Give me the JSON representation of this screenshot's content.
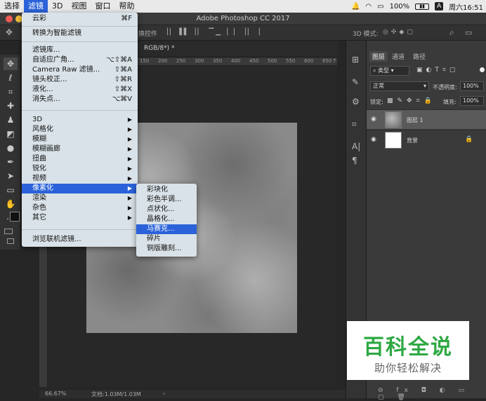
{
  "menubar": {
    "items": [
      "选择",
      "滤镜",
      "3D",
      "视图",
      "窗口",
      "帮助"
    ],
    "active_index": 1,
    "battery": "100%",
    "input_method": "A",
    "clock": "周六16:51"
  },
  "window": {
    "title": "Adobe Photoshop CC 2017"
  },
  "options_bar": {
    "label": "换控件",
    "mode_label": "3D 模式:"
  },
  "document": {
    "tab_label": "RGB/8*) *",
    "ruler_ticks": [
      "150",
      "200",
      "250",
      "300",
      "350",
      "400",
      "450",
      "500",
      "550",
      "600",
      "650",
      "7"
    ],
    "zoom": "66.67%",
    "doc_info": "文档:1.03M/1.03M"
  },
  "filter_menu": {
    "items": [
      {
        "label": "云彩",
        "shortcut": "⌘F"
      },
      {
        "label": "转换为智能滤镜",
        "shortcut": ""
      },
      {
        "label": "滤镜库...",
        "shortcut": ""
      },
      {
        "label": "自适应广角...",
        "shortcut": "⌥⇧⌘A"
      },
      {
        "label": "Camera Raw 滤镜...",
        "shortcut": "⇧⌘A"
      },
      {
        "label": "镜头校正...",
        "shortcut": "⇧⌘R"
      },
      {
        "label": "液化...",
        "shortcut": "⇧⌘X"
      },
      {
        "label": "消失点...",
        "shortcut": "⌥⌘V"
      },
      {
        "label": "3D",
        "shortcut": ""
      },
      {
        "label": "风格化",
        "shortcut": ""
      },
      {
        "label": "模糊",
        "shortcut": ""
      },
      {
        "label": "模糊画廊",
        "shortcut": ""
      },
      {
        "label": "扭曲",
        "shortcut": ""
      },
      {
        "label": "锐化",
        "shortcut": ""
      },
      {
        "label": "视频",
        "shortcut": ""
      },
      {
        "label": "像素化",
        "shortcut": ""
      },
      {
        "label": "渲染",
        "shortcut": ""
      },
      {
        "label": "杂色",
        "shortcut": ""
      },
      {
        "label": "其它",
        "shortcut": ""
      },
      {
        "label": "浏览联机滤镜...",
        "shortcut": ""
      }
    ],
    "highlighted": "像素化"
  },
  "pixelate_submenu": {
    "items": [
      "彩块化",
      "彩色半调...",
      "点状化...",
      "晶格化...",
      "马赛克...",
      "碎片",
      "铜版雕刻..."
    ],
    "highlighted": "马赛克..."
  },
  "layers_panel": {
    "tabs": [
      "图层",
      "通道",
      "路径"
    ],
    "filter_kind": "类型",
    "blend_mode": "正常",
    "opacity_label": "不透明度:",
    "opacity_value": "100%",
    "lock_label": "锁定:",
    "fill_label": "填充:",
    "fill_value": "100%",
    "layers": [
      {
        "name": "图层 1"
      },
      {
        "name": "背景"
      }
    ]
  },
  "watermark": {
    "title": "百科全说",
    "subtitle": "助你轻松解决"
  },
  "colors": {
    "accent": "#2b62d9",
    "watermark_green": "#2ea843"
  }
}
